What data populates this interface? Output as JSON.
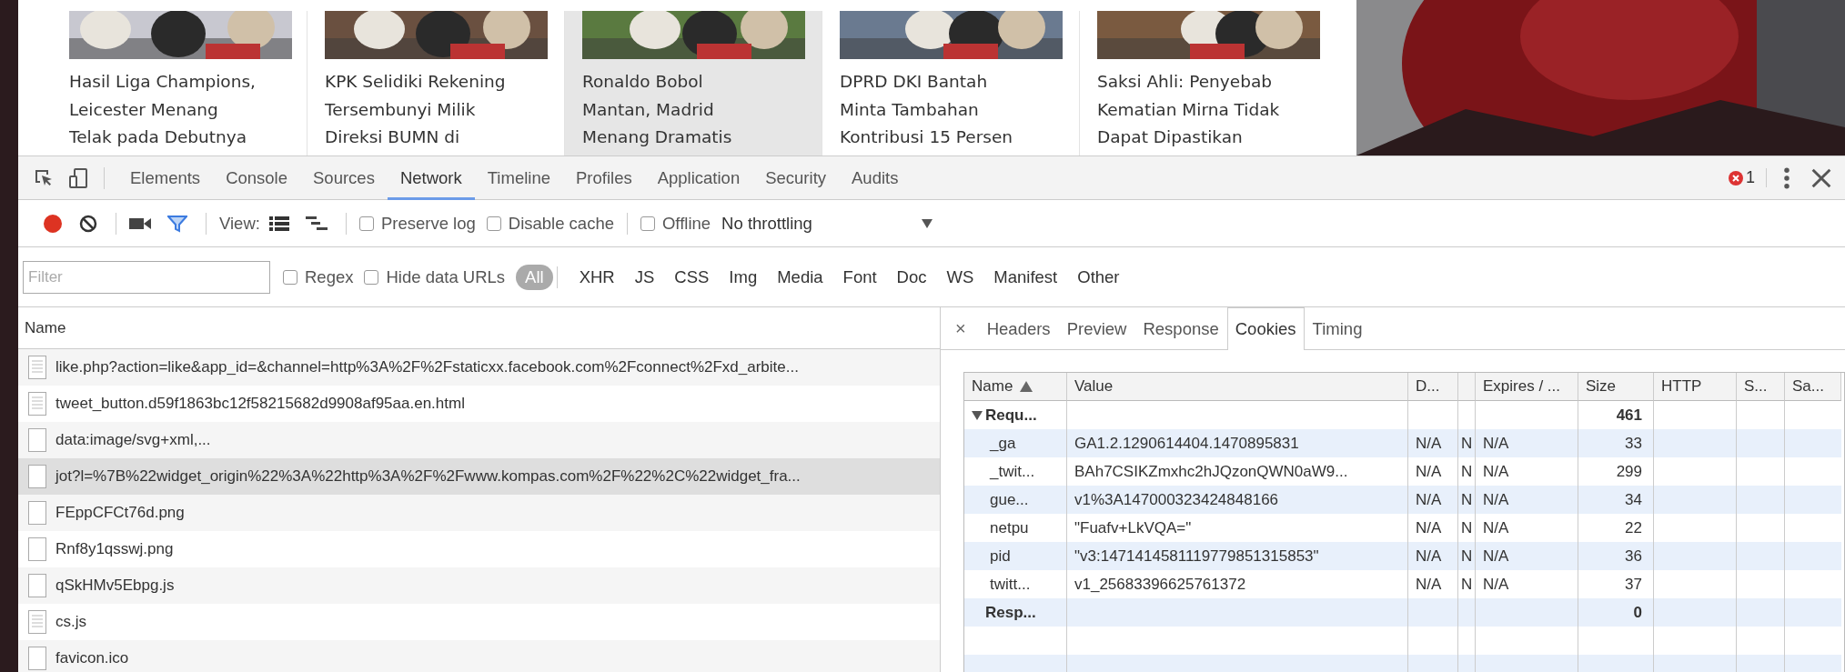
{
  "website": {
    "articles": [
      {
        "lines": [
          "Hasil Liga Champions,",
          "Leicester Menang",
          "Telak pada Debutnya"
        ],
        "highlighted": false
      },
      {
        "lines": [
          "KPK Selidiki Rekening",
          "Tersembunyi Milik",
          "Direksi BUMN di"
        ],
        "highlighted": false
      },
      {
        "lines": [
          "Ronaldo Bobol",
          "Mantan, Madrid",
          "Menang Dramatis"
        ],
        "highlighted": true
      },
      {
        "lines": [
          "DPRD DKI Bantah",
          "Minta Tambahan",
          "Kontribusi 15 Persen"
        ],
        "highlighted": false
      },
      {
        "lines": [
          "Saksi Ahli: Penyebab",
          "Kematian Mirna Tidak",
          "Dapat Dipastikan"
        ],
        "highlighted": false
      }
    ]
  },
  "devtools": {
    "tabs": [
      {
        "label": "Elements",
        "selected": false
      },
      {
        "label": "Console",
        "selected": false
      },
      {
        "label": "Sources",
        "selected": false
      },
      {
        "label": "Network",
        "selected": true
      },
      {
        "label": "Timeline",
        "selected": false
      },
      {
        "label": "Profiles",
        "selected": false
      },
      {
        "label": "Application",
        "selected": false
      },
      {
        "label": "Security",
        "selected": false
      },
      {
        "label": "Audits",
        "selected": false
      }
    ],
    "error_count": "1",
    "toolbar": {
      "recording": true,
      "view_label": "View:",
      "preserve_log": {
        "label": "Preserve log",
        "checked": false
      },
      "disable_cache": {
        "label": "Disable cache",
        "checked": false
      },
      "offline": {
        "label": "Offline",
        "checked": false
      },
      "throttling": "No throttling"
    },
    "filter": {
      "placeholder": "Filter",
      "regex": {
        "label": "Regex",
        "checked": false
      },
      "hide_data_urls": {
        "label": "Hide data URLs",
        "checked": false
      },
      "types": [
        {
          "label": "All",
          "selected": true
        },
        {
          "label": "XHR",
          "selected": false
        },
        {
          "label": "JS",
          "selected": false
        },
        {
          "label": "CSS",
          "selected": false
        },
        {
          "label": "Img",
          "selected": false
        },
        {
          "label": "Media",
          "selected": false
        },
        {
          "label": "Font",
          "selected": false
        },
        {
          "label": "Doc",
          "selected": false
        },
        {
          "label": "WS",
          "selected": false
        },
        {
          "label": "Manifest",
          "selected": false
        },
        {
          "label": "Other",
          "selected": false
        }
      ]
    },
    "requests": {
      "column": "Name",
      "rows": [
        {
          "name": "like.php?action=like&app_id=&channel=http%3A%2F%2Fstaticxx.facebook.com%2Fconnect%2Fxd_arbite...",
          "kind": "document",
          "selected": false
        },
        {
          "name": "tweet_button.d59f1863bc12f58215682d9908af95aa.en.html",
          "kind": "document",
          "selected": false
        },
        {
          "name": "data:image/svg+xml,...",
          "kind": "file",
          "selected": false
        },
        {
          "name": "jot?l=%7B%22widget_origin%22%3A%22http%3A%2F%2Fwww.kompas.com%2F%22%2C%22widget_fra...",
          "kind": "file",
          "selected": true
        },
        {
          "name": "FEppCFCt76d.png",
          "kind": "file",
          "selected": false
        },
        {
          "name": "Rnf8y1qsswj.png",
          "kind": "file",
          "selected": false
        },
        {
          "name": "qSkHMv5Ebpg.js",
          "kind": "file",
          "selected": false
        },
        {
          "name": "cs.js",
          "kind": "document",
          "selected": false
        },
        {
          "name": "favicon.ico",
          "kind": "file",
          "selected": false
        }
      ]
    },
    "detail": {
      "close": "×",
      "tabs": [
        {
          "label": "Headers",
          "selected": false
        },
        {
          "label": "Preview",
          "selected": false
        },
        {
          "label": "Response",
          "selected": false
        },
        {
          "label": "Cookies",
          "selected": true
        },
        {
          "label": "Timing",
          "selected": false
        }
      ],
      "cookies": {
        "columns": [
          {
            "label": "Name",
            "sorted": true
          },
          {
            "label": "Value",
            "sorted": false
          },
          {
            "label": "D...",
            "sorted": false
          },
          {
            "sorted": false
          },
          {
            "label": "Expires / ...",
            "sorted": false
          },
          {
            "label": "Size",
            "sorted": false
          },
          {
            "label": "HTTP",
            "sorted": false
          },
          {
            "label": "S...",
            "sorted": false
          },
          {
            "label": "Sa...",
            "sorted": false
          }
        ],
        "rows": [
          {
            "kind": "group",
            "name": "Requ...",
            "expanded": true,
            "size": "461"
          },
          {
            "kind": "cookie",
            "name": "_ga",
            "value": "GA1.2.1290614404.1470895831",
            "domain": "N/A",
            "path": "N",
            "expires": "N/A",
            "size": "33"
          },
          {
            "kind": "cookie",
            "name": "_twit...",
            "value": "BAh7CSIKZmxhc2hJQzonQWN0aW9...",
            "domain": "N/A",
            "path": "N",
            "expires": "N/A",
            "size": "299"
          },
          {
            "kind": "cookie",
            "name": "gue...",
            "value": "v1%3A147000323424848166",
            "domain": "N/A",
            "path": "N",
            "expires": "N/A",
            "size": "34"
          },
          {
            "kind": "cookie",
            "name": "netpu",
            "value": "\"Fuafv+LkVQA=\"",
            "domain": "N/A",
            "path": "N",
            "expires": "N/A",
            "size": "22"
          },
          {
            "kind": "cookie",
            "name": "pid",
            "value": "\"v3:1471414581119779851315853\"",
            "domain": "N/A",
            "path": "N",
            "expires": "N/A",
            "size": "36"
          },
          {
            "kind": "cookie",
            "name": "twitt...",
            "value": "v1_25683396625761372",
            "domain": "N/A",
            "path": "N",
            "expires": "N/A",
            "size": "37"
          },
          {
            "kind": "total",
            "name": "Resp...",
            "size": "0"
          }
        ]
      }
    }
  }
}
